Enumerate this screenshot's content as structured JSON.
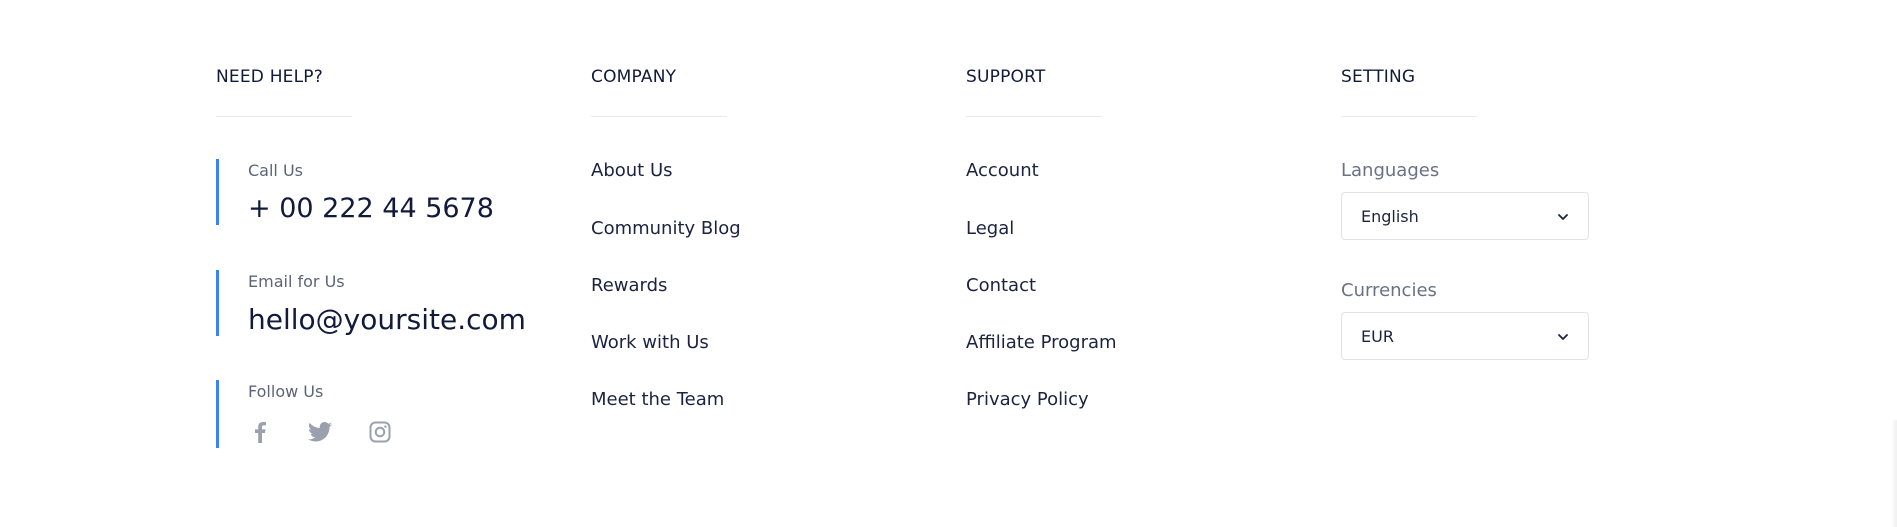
{
  "help": {
    "title": "NEED HELP?",
    "call_label": "Call Us",
    "call_value": "+ 00 222 44 5678",
    "email_label": "Email for Us",
    "email_value": "hello@yoursite.com",
    "follow_label": "Follow Us",
    "socials": [
      "facebook-icon",
      "twitter-icon",
      "instagram-icon"
    ]
  },
  "company": {
    "title": "COMPANY",
    "links": [
      "About Us",
      "Community Blog",
      "Rewards",
      "Work with Us",
      "Meet the Team"
    ]
  },
  "support": {
    "title": "SUPPORT",
    "links": [
      "Account",
      "Legal",
      "Contact",
      "Affiliate Program",
      "Privacy Policy"
    ]
  },
  "setting": {
    "title": "SETTING",
    "languages_label": "Languages",
    "language_value": "English",
    "currencies_label": "Currencies",
    "currency_value": "EUR"
  },
  "colors": {
    "accent": "#3b82f6",
    "text": "#111a3a",
    "muted": "#6b7185",
    "icon": "#9aa0ad"
  }
}
